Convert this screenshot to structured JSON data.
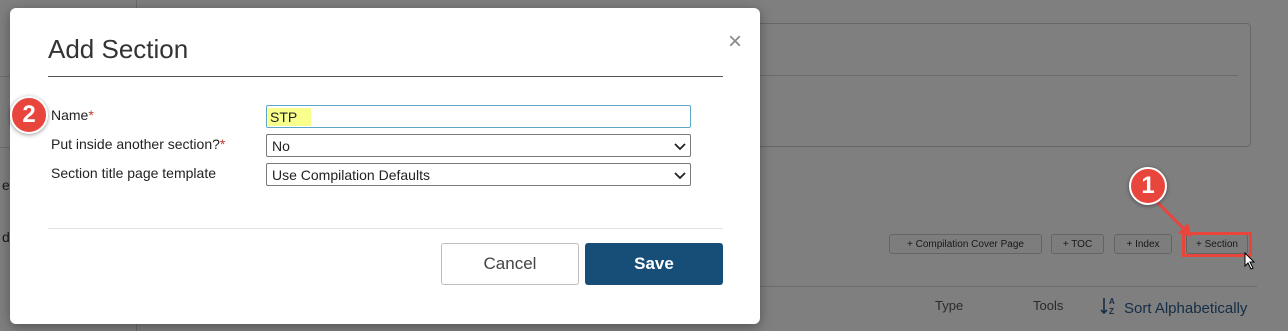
{
  "background": {
    "left_fragments": [
      "e",
      "d"
    ],
    "buttons": [
      "+ Compilation Cover Page",
      "+ TOC",
      "+ Index",
      "+ Section"
    ],
    "table_columns": [
      "Type",
      "Tools"
    ],
    "sort_label": "Sort Alphabetically"
  },
  "annotations": {
    "step_1": "1",
    "step_2": "2",
    "accent_color": "#e8453c"
  },
  "modal": {
    "title": "Add Section",
    "close_icon": "close-icon",
    "fields": {
      "name_label": "Name",
      "name_value": "STP",
      "parent_label": "Put inside another section?",
      "parent_value": "No",
      "template_label": "Section title page template",
      "template_value": "Use Compilation Defaults"
    },
    "required_marker": "*",
    "cancel_label": "Cancel",
    "save_label": "Save",
    "save_color": "#174e78"
  }
}
